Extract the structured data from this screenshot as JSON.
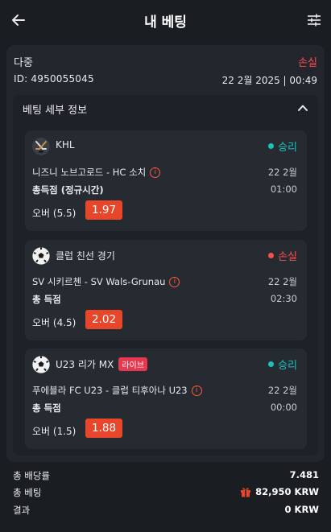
{
  "header": {
    "title": "내 베팅",
    "back_icon": "arrow-left-icon",
    "settings_icon": "sliders-icon"
  },
  "bet": {
    "type": "다중",
    "status": "손실",
    "id": "ID: 4950055045",
    "datetime": "22 2월 2025 | 00:49"
  },
  "details": {
    "title": "베팅 세부 정보",
    "legs": [
      {
        "league": "KHL",
        "live": "",
        "result": "승리",
        "result_color": "#19c3bd",
        "match": "니즈니 노브고로드 - HC 소치",
        "date": "22 2월",
        "market": "총득점 (정규시간)",
        "time": "01:00",
        "selection": "오버 (5.5)",
        "odds": "1.97",
        "icon": "hockey-icon"
      },
      {
        "league": "클럽 친선 경기",
        "live": "",
        "result": "손실",
        "result_color": "#ff4d4d",
        "match": "SV 시키르첸 - SV Wals-Grunau",
        "date": "22 2월",
        "market": "총 득점",
        "time": "02:30",
        "selection": "오버 (4.5)",
        "odds": "2.02",
        "icon": "soccer-ball-icon"
      },
      {
        "league": "U23 리가 MX",
        "live": "라이브",
        "result": "승리",
        "result_color": "#19c3bd",
        "match": "푸에블라 FC U23 - 클럽 티후아나 U23",
        "date": "22 2월",
        "market": "총 득점",
        "time": "00:00",
        "selection": "오버 (1.5)",
        "odds": "1.88",
        "icon": "soccer-ball-icon"
      }
    ]
  },
  "summary": {
    "total_odds_label": "총 배당률",
    "total_odds": "7.481",
    "total_stake_label": "총 베팅",
    "total_stake": "82,950 KRW",
    "result_label": "결과",
    "result": "0 KRW"
  }
}
